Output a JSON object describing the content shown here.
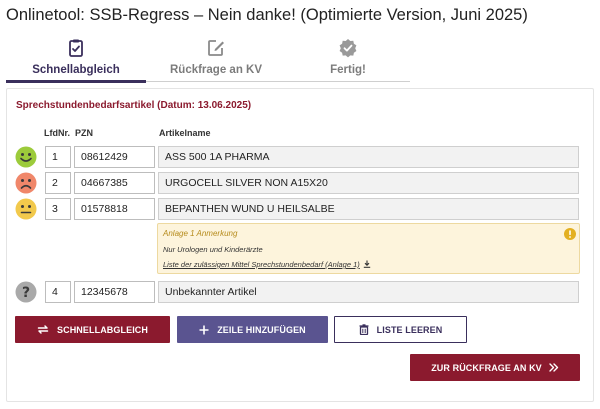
{
  "page": {
    "title": "Onlinetool: SSB-Regress – Nein danke! (Optimierte Version, Juni 2025)"
  },
  "tabs": [
    {
      "label": "Schnellabgleich",
      "icon": "clipboard-check-icon",
      "active": true
    },
    {
      "label": "Rückfrage an KV",
      "icon": "edit-icon",
      "active": false
    },
    {
      "label": "Fertig!",
      "icon": "check-badge-icon",
      "active": false
    }
  ],
  "section": {
    "title": "Sprechstundenbedarfsartikel (Datum: 13.06.2025)"
  },
  "table": {
    "headers": {
      "lfdnr": "LfdNr.",
      "pzn": "PZN",
      "name": "Artikelname"
    },
    "rows": [
      {
        "status": "green-happy",
        "lfdnr": "1",
        "pzn": "08612429",
        "name": "ASS 500 1A PHARMA"
      },
      {
        "status": "red-sad",
        "lfdnr": "2",
        "pzn": "04667385",
        "name": "URGOCELL SILVER NON A15X20"
      },
      {
        "status": "yellow-neutral",
        "lfdnr": "3",
        "pzn": "01578818",
        "name": "BEPANTHEN WUND U HEILSALBE"
      },
      {
        "status": "unknown",
        "lfdnr": "4",
        "pzn": "12345678",
        "name": "Unbekannter Artikel"
      }
    ]
  },
  "annotation": {
    "title": "Anlage 1 Anmerkung",
    "text": "Nur Urologen und Kinderärzte",
    "link": "Liste der zulässigen Mittel Sprechstundenbedarf (Anlage 1)"
  },
  "buttons": {
    "schnellabgleich": "SCHNELLABGLEICH",
    "add_row": "ZEILE HINZUFÜGEN",
    "clear_list": "LISTE LEEREN",
    "next": "ZUR RÜCKFRAGE AN KV"
  },
  "colors": {
    "primary": "#8b1a2e",
    "secondary": "#5a5490",
    "dark": "#3a2f5c",
    "notice_bg": "#fdf4dc"
  }
}
